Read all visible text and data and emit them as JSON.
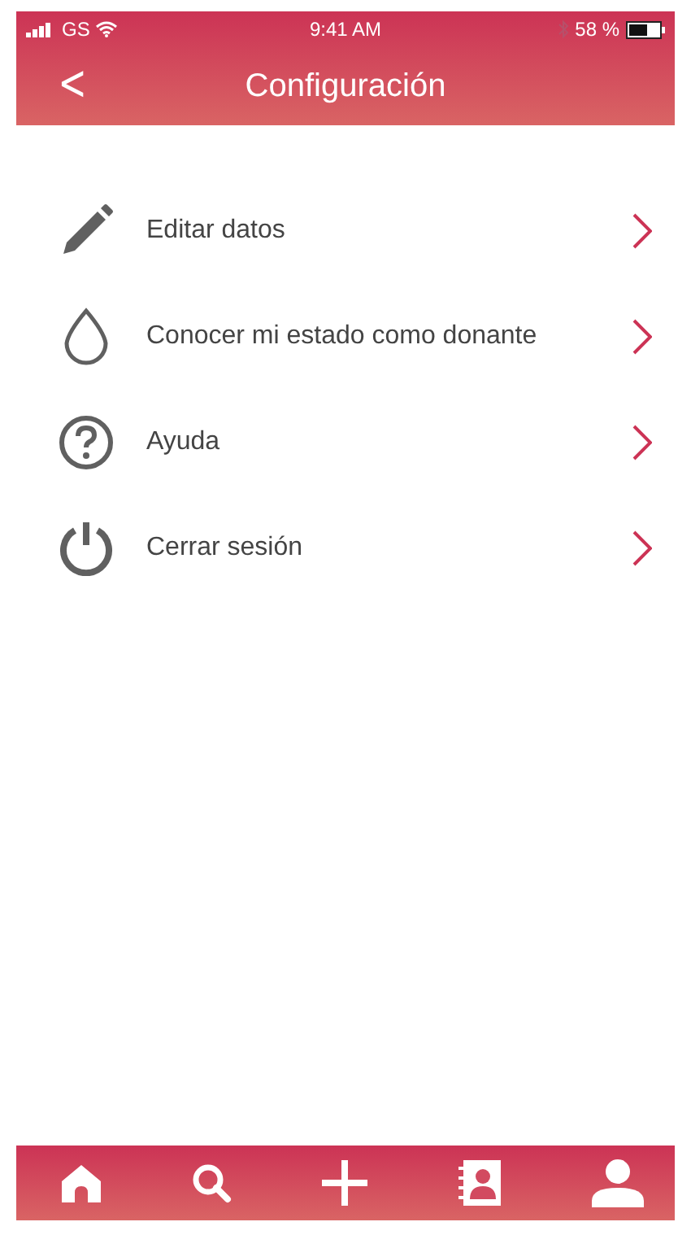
{
  "status_bar": {
    "carrier": "GS",
    "time": "9:41 AM",
    "battery": "58 %"
  },
  "header": {
    "back": "<",
    "title": "Configuración"
  },
  "menu_items": [
    {
      "kind": "pencil",
      "label": "Editar datos"
    },
    {
      "kind": "drop",
      "label": "Conocer mi estado como donante"
    },
    {
      "kind": "help",
      "label": "Ayuda"
    },
    {
      "kind": "power",
      "label": "Cerrar sesión"
    }
  ],
  "tab_bar": [
    {
      "kind": "home"
    },
    {
      "kind": "search"
    },
    {
      "kind": "add"
    },
    {
      "kind": "contacts"
    },
    {
      "kind": "profile"
    }
  ]
}
